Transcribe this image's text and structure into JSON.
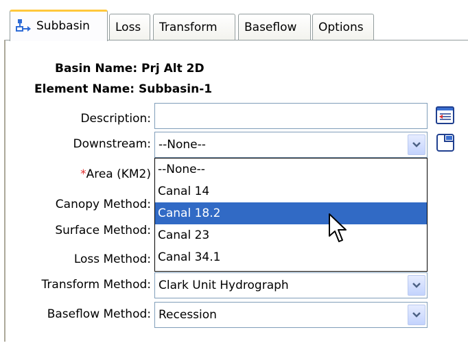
{
  "tabs": [
    {
      "label": "Subbasin",
      "active": true
    },
    {
      "label": "Loss"
    },
    {
      "label": "Transform"
    },
    {
      "label": "Baseflow"
    },
    {
      "label": "Options"
    }
  ],
  "form": {
    "basin_name": "Basin Name: Prj Alt 2D",
    "element_name": "Element Name: Subbasin-1",
    "description_label": "Description:",
    "description_value": "",
    "downstream_label": "Downstream:",
    "downstream_value": "--None--",
    "area_required_mark": "*",
    "area_label": "Area (KM2)",
    "canopy_label": "Canopy Method:",
    "surface_label": "Surface Method:",
    "loss_label": "Loss Method:",
    "transform_label": "Transform Method:",
    "transform_value": "Clark Unit Hydrograph",
    "baseflow_label": "Baseflow Method:",
    "baseflow_value": "Recession"
  },
  "downstream_options": [
    "--None--",
    "Canal 14",
    "Canal 18.2",
    "Canal 23",
    "Canal 34.1"
  ],
  "downstream_highlighted": "Canal 18.2",
  "icons": {
    "subbasin_tab": "subbasin-icon",
    "description_button": "description-editor-icon",
    "downstream_button": "select-element-icon",
    "dropdown_arrow": "chevron-down-icon"
  },
  "colors": {
    "selection": "#316ac5",
    "active_tab_accent": "#ffc83c",
    "field_border": "#7f9db9",
    "required_mark": "#e03030"
  }
}
